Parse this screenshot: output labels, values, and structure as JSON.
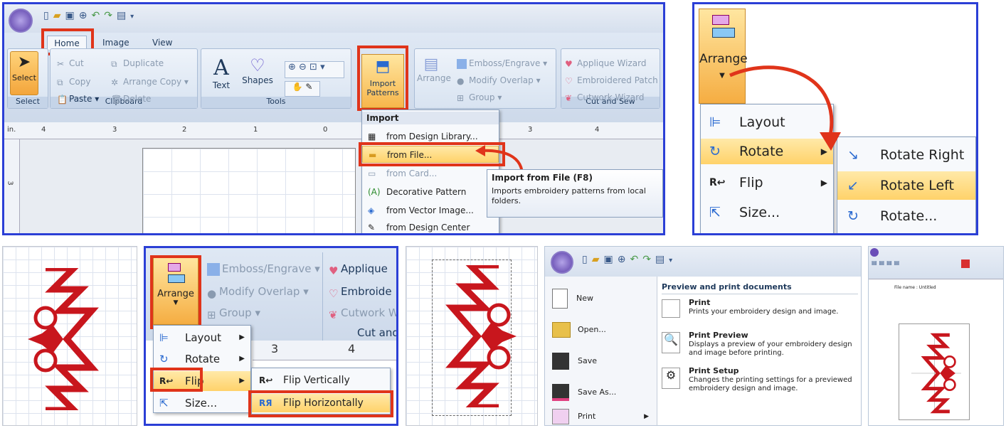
{
  "p1": {
    "tabs": [
      "Home",
      "Image",
      "View"
    ],
    "clipboard": {
      "cut": "Cut",
      "copy": "Copy",
      "paste": "Paste",
      "duplicate": "Duplicate",
      "arrange_copy": "Arrange Copy",
      "delete": "Delete",
      "group_label": "Clipboard"
    },
    "select": {
      "label": "Select",
      "group_label": "Select"
    },
    "tools": {
      "text": "Text",
      "shapes": "Shapes",
      "group_label": "Tools"
    },
    "import_btn": {
      "line1": "Import",
      "line2": "Patterns"
    },
    "arrange": {
      "label": "Arrange",
      "emboss": "Emboss/Engrave",
      "modify": "Modify Overlap",
      "group": "Group"
    },
    "cut_sew": {
      "applique": "Applique Wizard",
      "patch": "Embroidered Patch",
      "cutwork": "Cutwork Wizard",
      "group_label": "Cut and Sew"
    },
    "import_menu": {
      "header": "Import",
      "items": [
        "from Design Library...",
        "from File...",
        "from Card...",
        "Decorative Pattern",
        "from Vector Image...",
        "from Design Center"
      ]
    },
    "tooltip": {
      "title": "Import from File (F8)",
      "body": "Imports embroidery patterns from local folders."
    },
    "ruler": {
      "unit": "in.",
      "ticks": [
        "4",
        "3",
        "2",
        "1",
        "0",
        "3",
        "4"
      ],
      "vtick": "3"
    }
  },
  "p2": {
    "arrange_label": "Arrange",
    "menu": [
      "Layout",
      "Rotate",
      "Flip",
      "Size..."
    ],
    "sub": [
      "Rotate Right",
      "Rotate Left",
      "Rotate..."
    ]
  },
  "p4": {
    "arrange_label": "Arrange",
    "emboss": "Emboss/Engrave",
    "modify": "Modify Overlap",
    "group": "Group",
    "applique": "Applique",
    "embroide": "Embroide",
    "cutwork": "Cutwork W",
    "cut_and": "Cut and",
    "menu": [
      "Layout",
      "Rotate",
      "Flip",
      "Size..."
    ],
    "sub": [
      "Flip Vertically",
      "Flip Horizontally"
    ],
    "ticks": [
      "3",
      "4"
    ]
  },
  "p6": {
    "menu": [
      "New",
      "Open...",
      "Save",
      "Save As...",
      "Print"
    ],
    "header": "Preview and print documents",
    "entries": [
      {
        "title": "Print",
        "desc": "Prints your embroidery design and image."
      },
      {
        "title": "Print Preview",
        "desc": "Displays a preview of your embroidery design and image before printing."
      },
      {
        "title": "Print Setup",
        "desc": "Changes the printing settings for a previewed embroidery design and image."
      }
    ]
  },
  "p7": {
    "file_name": "File name : Untitled"
  },
  "colors": {
    "accent": "#e0341a",
    "border": "#2b3fd6",
    "design": "#c8161d"
  }
}
